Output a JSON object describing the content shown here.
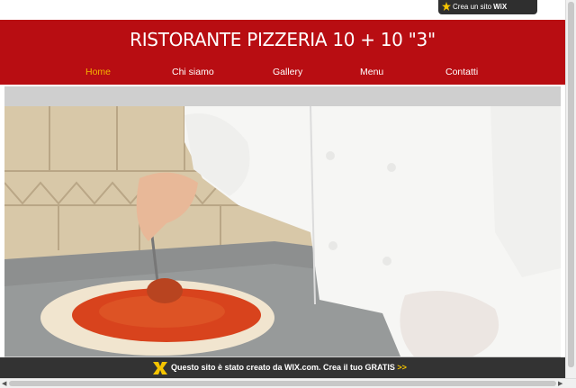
{
  "wix_top": {
    "prefix": "Crea un sito",
    "brand": "WiX"
  },
  "header": {
    "title": "RISTORANTE PIZZERIA 10 + 10 \"3\"",
    "nav": [
      {
        "label": "Home",
        "active": true
      },
      {
        "label": "Chi siamo",
        "active": false
      },
      {
        "label": "Gallery",
        "active": false
      },
      {
        "label": "Menu",
        "active": false
      },
      {
        "label": "Contatti",
        "active": false
      }
    ]
  },
  "banner": {
    "text": "Questo sito è stato creato da WIX.com. Crea il tuo GRATIS",
    "arrows": ">>"
  },
  "colors": {
    "header_bg": "#b80d12",
    "active_nav": "#f5b400",
    "banner_bg": "#333333"
  }
}
